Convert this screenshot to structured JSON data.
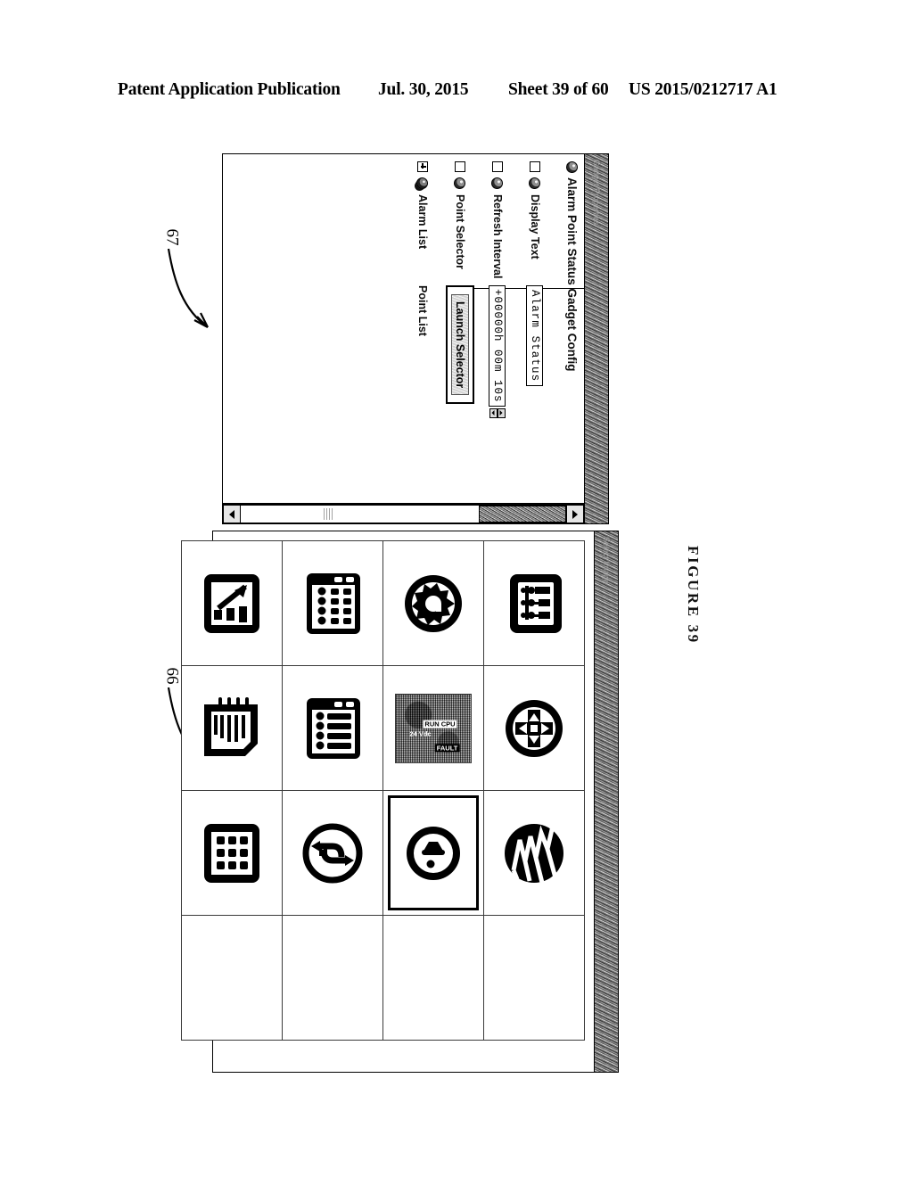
{
  "header": {
    "publication": "Patent Application Publication",
    "date": "Jul. 30, 2015",
    "sheet": "Sheet 39 of 60",
    "patent_number": "US 2015/0212717 A1"
  },
  "figure": {
    "caption": "FIGURE 39",
    "ref_config_dialog": "67",
    "ref_icon_picker": "66"
  },
  "config_dialog": {
    "titlebar_text": "Gadget Properties",
    "tree_title": "Alarm Point Status Gadget Config",
    "rows": [
      {
        "label": "Display Text",
        "control": "textfield",
        "value": "Alarm Status"
      },
      {
        "label": "Refresh Interval",
        "control": "spinner",
        "value": "+00000h 00m 10s"
      },
      {
        "label": "Point Selector",
        "control": "button",
        "value": "Launch Selector"
      },
      {
        "label": "Alarm List",
        "control": "text",
        "value": "Point List"
      }
    ],
    "scrollbar": {
      "up_arrow": "scroll-up",
      "down_arrow": "scroll-down"
    }
  },
  "icon_picker": {
    "titlebar_text": "Select Image",
    "icons": [
      {
        "name": "controller-terminal-icon",
        "alt": "Controller with terminals"
      },
      {
        "name": "network-hub-icon",
        "alt": "Circular network hub"
      },
      {
        "name": "lightning-waveform-icon",
        "alt": "Lightning waveform disc"
      },
      {
        "name": "empty-cell",
        "alt": ""
      },
      {
        "name": "gear-settings-icon",
        "alt": "Gear in circle"
      },
      {
        "name": "device-photo-thumbnail",
        "alt": "Halftone device photo"
      },
      {
        "name": "speaker-audio-icon",
        "alt": "Speaker in circle"
      },
      {
        "name": "empty-cell",
        "alt": ""
      },
      {
        "name": "keypad-grid-icon",
        "alt": "Keypad grid panel"
      },
      {
        "name": "slider-bank-icon",
        "alt": "Vertical slider bank"
      },
      {
        "name": "refresh-cycle-icon",
        "alt": "Refresh arrows in circle"
      },
      {
        "name": "empty-cell",
        "alt": ""
      },
      {
        "name": "trend-chart-icon",
        "alt": "Trend arrow with bars"
      },
      {
        "name": "notebook-list-icon",
        "alt": "Spiral notebook list"
      },
      {
        "name": "numeric-keypad-icon",
        "alt": "Numeric keypad"
      },
      {
        "name": "empty-cell",
        "alt": ""
      }
    ],
    "selected_index": 6,
    "photo_labels": {
      "a": "RUN  CPU",
      "b": "FAULT",
      "c": "24 Vdc"
    }
  }
}
